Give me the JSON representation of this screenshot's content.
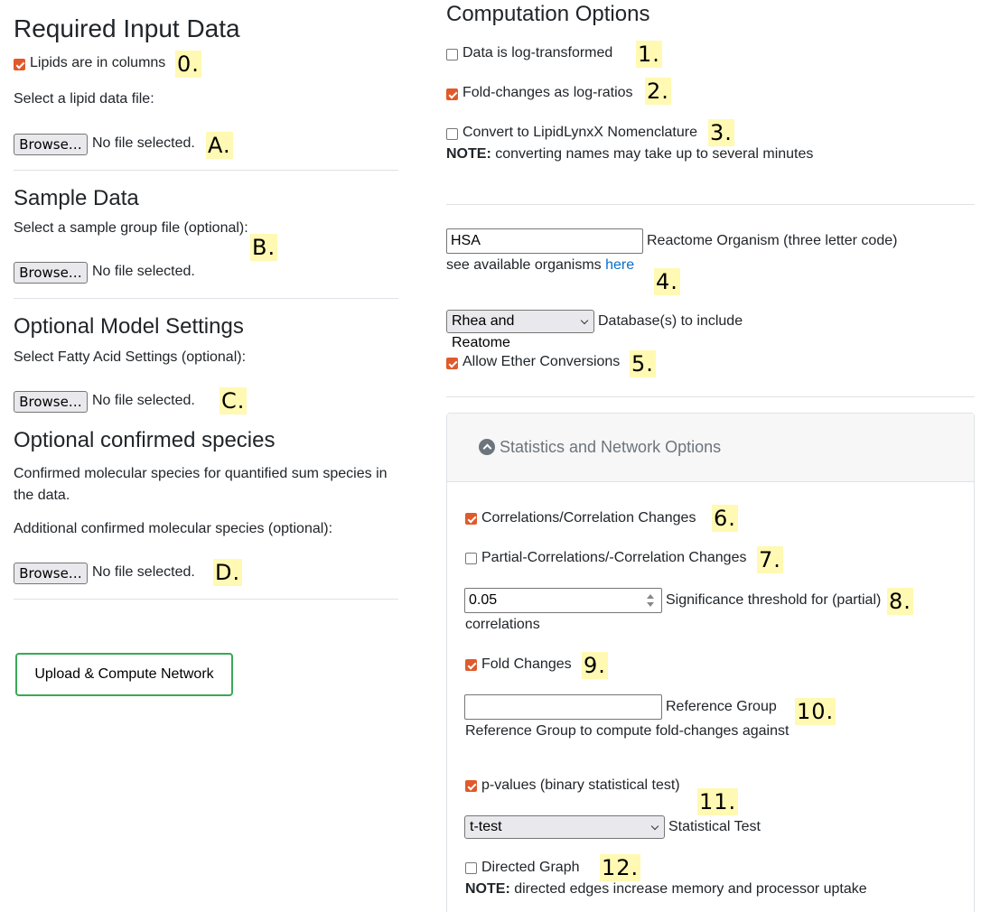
{
  "left": {
    "required": {
      "title": "Required Input Data",
      "lipids_in_columns": {
        "label": "Lipids are in columns",
        "checked": true
      },
      "select_lipid_label": "Select a lipid data file:"
    },
    "sample": {
      "title": "Sample Data",
      "select_label": "Select a sample group file (optional):"
    },
    "model": {
      "title": "Optional Model Settings",
      "select_label": "Select Fatty Acid Settings (optional):"
    },
    "confirmed": {
      "title": "Optional confirmed species",
      "description": "Confirmed molecular species for quantified sum species in the data.",
      "select_label": "Additional confirmed molecular species (optional):"
    },
    "file_input": {
      "browse_label": "Browse…",
      "status": "No file selected."
    },
    "upload_button": "Upload & Compute Network"
  },
  "right": {
    "title": "Computation Options",
    "log_transformed": {
      "label": "Data is log-transformed",
      "checked": false
    },
    "fold_changes_log": {
      "label": "Fold-changes as log-ratios",
      "checked": true
    },
    "convert_lynx": {
      "label": "Convert to LipidLynxX Nomenclature",
      "checked": false
    },
    "note1": {
      "bold": "NOTE:",
      "text": " converting names may take up to several minutes"
    },
    "organism": {
      "value": "HSA",
      "label": "Reactome Organism (three letter code)",
      "see_text": "see available organisms ",
      "link_text": "here"
    },
    "database": {
      "value": "Rhea and Reatome",
      "label": "Database(s) to include"
    },
    "ether": {
      "label": "Allow Ether Conversions",
      "checked": true
    },
    "stats": {
      "header": "Statistics and Network Options",
      "correlations": {
        "label": "Correlations/Correlation Changes",
        "checked": true
      },
      "partial": {
        "label": "Partial-Correlations/-Correlation Changes",
        "checked": false
      },
      "threshold": {
        "value": "0.05",
        "label": "Significance threshold for (partial)",
        "label2": "correlations"
      },
      "fold_changes": {
        "label": "Fold Changes",
        "checked": true
      },
      "reference": {
        "value": "",
        "label": "Reference Group",
        "help": "Reference Group to compute fold-changes against"
      },
      "pvalues": {
        "label": "p-values (binary statistical test)",
        "checked": true
      },
      "test": {
        "value": "t-test",
        "label": "Statistical Test"
      },
      "directed": {
        "label": "Directed Graph",
        "checked": false
      },
      "note2": {
        "bold": "NOTE:",
        "text": " directed edges increase memory and processor uptake"
      }
    }
  },
  "markers": [
    "0.",
    "A.",
    "B.",
    "C.",
    "D.",
    "1.",
    "2.",
    "3.",
    "4.",
    "5.",
    "6.",
    "7.",
    "8.",
    "9.",
    "10.",
    "11.",
    "12."
  ],
  "colors": {
    "checkbox_accent": "#e05a2b",
    "marker_bg": "#fff9b3",
    "upload_border": "#3aa856",
    "link": "#0a6ecb"
  }
}
